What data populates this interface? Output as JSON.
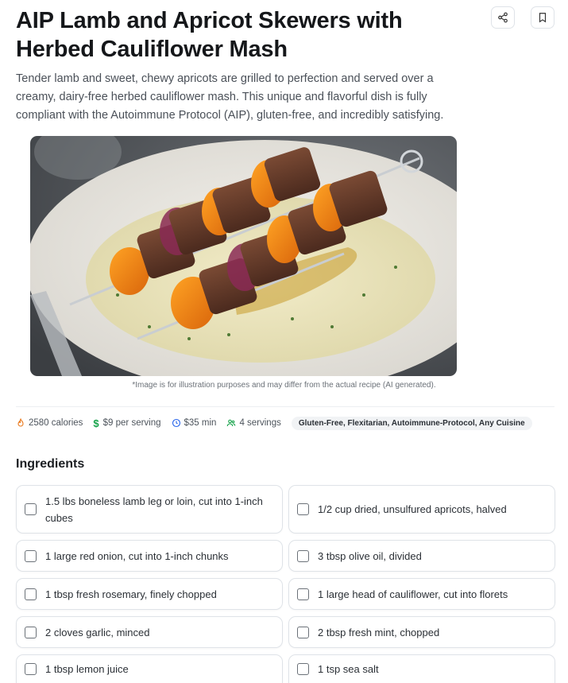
{
  "recipe": {
    "title": "AIP Lamb and Apricot Skewers with Herbed Cauliflower Mash",
    "description": "Tender lamb and sweet, chewy apricots are grilled to perfection and served over a creamy, dairy-free herbed cauliflower mash. This unique and flavorful dish is fully compliant with the Autoimmune Protocol (AIP), gluten-free, and incredibly satisfying.",
    "image_caption": "*Image is for illustration purposes and may differ from the actual recipe (AI generated)."
  },
  "actions": {
    "share_icon": "share-icon",
    "bookmark_icon": "bookmark-icon"
  },
  "meta": {
    "calories": "2580 calories",
    "cost": "$9 per serving",
    "time": "$35 min",
    "servings": "4 servings",
    "tags": "Gluten-Free, Flexitarian, Autoimmune-Protocol, Any Cuisine"
  },
  "ingredients": {
    "heading": "Ingredients",
    "items": [
      "1.5 lbs boneless lamb leg or loin, cut into 1-inch cubes",
      "1/2 cup dried, unsulfured apricots, halved",
      "1 large red onion, cut into 1-inch chunks",
      "3 tbsp olive oil, divided",
      "1 tbsp fresh rosemary, finely chopped",
      "1 large head of cauliflower, cut into florets",
      "2 cloves garlic, minced",
      "2 tbsp fresh mint, chopped",
      "1 tbsp lemon juice",
      "1 tsp sea salt"
    ]
  },
  "colors": {
    "accent_green": "#16a34a",
    "clock_blue": "#2563eb",
    "flame_orange": "#ea7a1e"
  }
}
